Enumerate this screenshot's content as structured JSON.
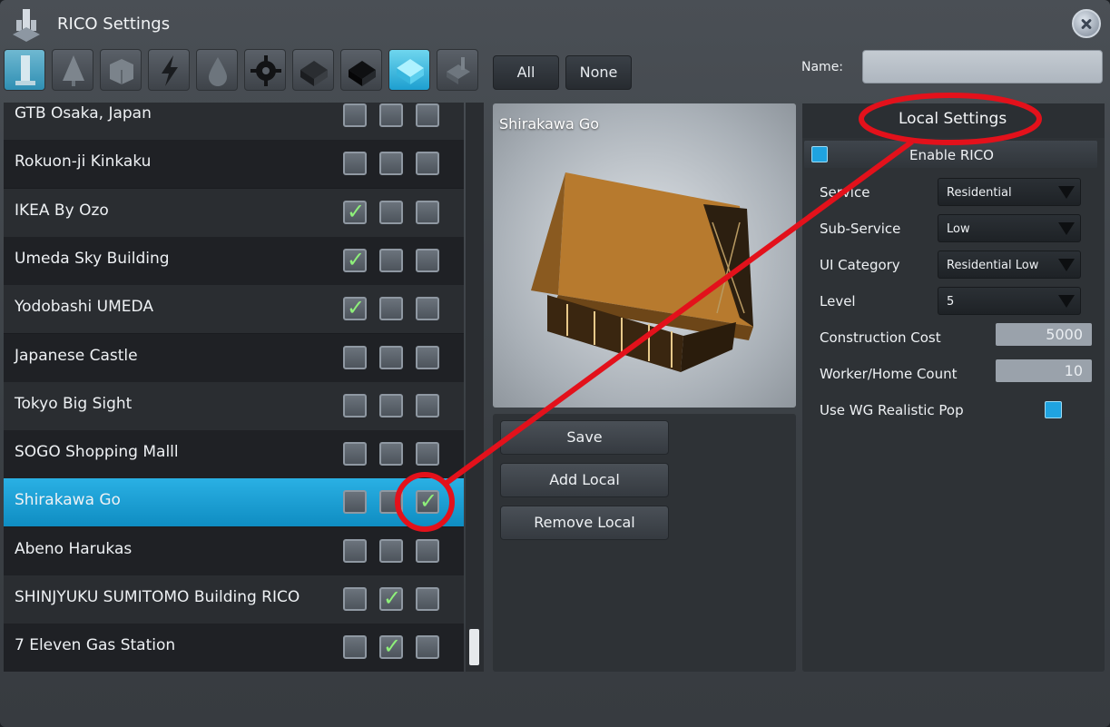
{
  "window": {
    "title": "RICO Settings"
  },
  "toolbar": {
    "icons": [
      "building-icon",
      "tree-icon",
      "box-icon",
      "lightning-icon",
      "water-drop-icon",
      "gear-icon",
      "office-icon",
      "industry-icon",
      "residential-icon",
      "extractor-icon"
    ],
    "all_label": "All",
    "none_label": "None"
  },
  "name_field": {
    "label": "Name:",
    "value": ""
  },
  "buildings": [
    {
      "name": "GTB Osaka, Japan",
      "checks": [
        false,
        false,
        false
      ]
    },
    {
      "name": "Rokuon-ji Kinkaku",
      "checks": [
        false,
        false,
        false
      ]
    },
    {
      "name": "IKEA By Ozo",
      "checks": [
        true,
        false,
        false
      ]
    },
    {
      "name": "Umeda Sky Building",
      "checks": [
        true,
        false,
        false
      ]
    },
    {
      "name": "Yodobashi UMEDA",
      "checks": [
        true,
        false,
        false
      ]
    },
    {
      "name": "Japanese Castle",
      "checks": [
        false,
        false,
        false
      ]
    },
    {
      "name": "Tokyo Big Sight",
      "checks": [
        false,
        false,
        false
      ]
    },
    {
      "name": "SOGO Shopping Malll",
      "checks": [
        false,
        false,
        false
      ]
    },
    {
      "name": "Shirakawa Go",
      "checks": [
        false,
        false,
        true
      ],
      "selected": true
    },
    {
      "name": "Abeno Harukas",
      "checks": [
        false,
        false,
        false
      ]
    },
    {
      "name": "SHINJYUKU SUMITOMO Building RICO",
      "checks": [
        false,
        true,
        false
      ]
    },
    {
      "name": "7 Eleven Gas Station",
      "checks": [
        false,
        true,
        false
      ]
    }
  ],
  "preview": {
    "title": "Shirakawa Go"
  },
  "actions": {
    "save": "Save",
    "add_local": "Add Local",
    "remove_local": "Remove Local"
  },
  "local_settings": {
    "title": "Local Settings",
    "enable_rico": {
      "label": "Enable RICO",
      "checked": true
    },
    "service": {
      "label": "Service",
      "value": "Residential"
    },
    "sub_service": {
      "label": "Sub-Service",
      "value": "Low"
    },
    "ui_category": {
      "label": "UI Category",
      "value": "Residential Low"
    },
    "level": {
      "label": "Level",
      "value": "5"
    },
    "construction_cost": {
      "label": "Construction Cost",
      "value": "5000"
    },
    "worker_home_count": {
      "label": "Worker/Home Count",
      "value": "10"
    },
    "use_wg_realistic_pop": {
      "label": "Use WG Realistic Pop",
      "checked": true
    }
  },
  "annotation_color": "#e3111b"
}
